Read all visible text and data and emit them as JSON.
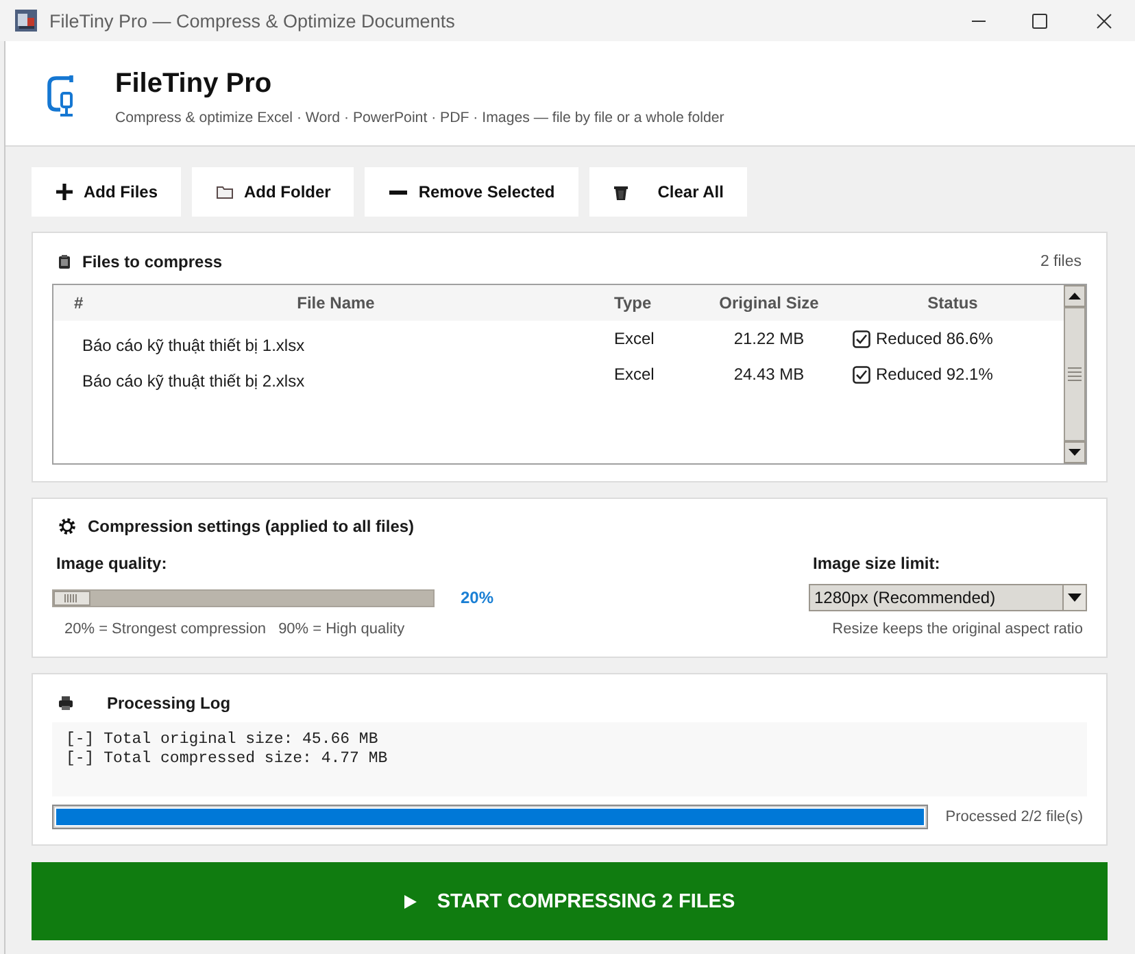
{
  "window": {
    "title": "FileTiny Pro — Compress & Optimize Documents"
  },
  "header": {
    "title": "FileTiny Pro",
    "subtitle": "Compress & optimize Excel · Word · PowerPoint · PDF · Images — file by file or a whole folder"
  },
  "toolbar": [
    {
      "label": "Add Files",
      "kind": "add"
    },
    {
      "label": "Add Folder",
      "kind": "folder"
    },
    {
      "label": "Remove Selected",
      "kind": "remove"
    },
    {
      "label": "Clear All",
      "kind": "clear"
    }
  ],
  "files": {
    "title": "Files to compress",
    "count": "2 files",
    "columns": [
      "#",
      "File Name",
      "Type",
      "Original Size",
      "Status"
    ],
    "rows": [
      {
        "name": "Báo cáo kỹ thuật thiết bị 1.xlsx",
        "type": "Excel",
        "size": "21.22 MB",
        "status": "Reduced 86.6%",
        "checked": true
      },
      {
        "name": "Báo cáo kỹ thuật thiết bị 2.xlsx",
        "type": "Excel",
        "size": "24.43 MB",
        "status": "Reduced 92.1%",
        "checked": true
      }
    ]
  },
  "settings": {
    "title": "Compression settings (applied to all files)",
    "quality": {
      "label": "Image quality:",
      "level": 0,
      "reading": "20%",
      "hint_min": "20% = Strongest compression",
      "hint_max": "90% = High quality"
    },
    "size_limit": {
      "label": "Image size limit:",
      "value": "1280px (Recommended)",
      "hint": "Resize keeps the original aspect ratio"
    }
  },
  "log": {
    "title": "Processing Log",
    "lines": [
      "[-] Total original size: 45.66 MB",
      "[-] Total compressed size: 4.77 MB"
    ],
    "progress": {
      "level": 1,
      "reading": "Processed 2/2 file(s)"
    }
  },
  "start_button": {
    "label": "START COMPRESSING 2 FILES"
  }
}
